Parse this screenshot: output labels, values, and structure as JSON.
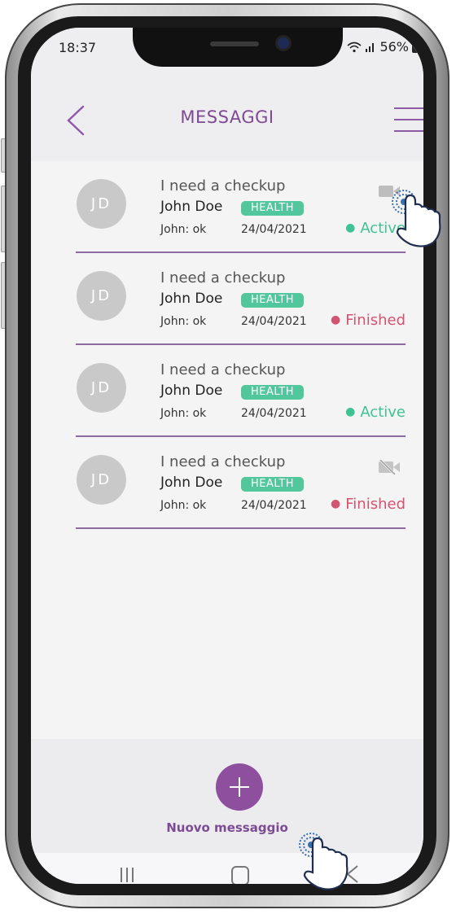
{
  "status_bar": {
    "time": "18:37",
    "battery": "56%"
  },
  "header": {
    "title": "MESSAGGI"
  },
  "conversations": [
    {
      "avatar": "JD",
      "subject": "I need a checkup",
      "name": "John Doe",
      "tag": "HEALTH",
      "preview": "John: ok",
      "date": "24/04/2021",
      "status": "Active",
      "video_icon": "video-camera-icon"
    },
    {
      "avatar": "JD",
      "subject": "I need a checkup",
      "name": "John Doe",
      "tag": "HEALTH",
      "preview": "John: ok",
      "date": "24/04/2021",
      "status": "Finished",
      "video_icon": ""
    },
    {
      "avatar": "JD",
      "subject": "I need a checkup",
      "name": "John Doe",
      "tag": "HEALTH",
      "preview": "John: ok",
      "date": "24/04/2021",
      "status": "Active",
      "video_icon": ""
    },
    {
      "avatar": "JD",
      "subject": "I need a checkup",
      "name": "John Doe",
      "tag": "HEALTH",
      "preview": "John: ok",
      "date": "24/04/2021",
      "status": "Finished",
      "video_icon": "video-off-icon"
    }
  ],
  "fab": {
    "label": "Nuovo messaggio",
    "icon": "plus-icon"
  },
  "colors": {
    "accent": "#8e4f9e",
    "active": "#3fc394",
    "finished": "#d25471",
    "tag": "#52c79c"
  }
}
